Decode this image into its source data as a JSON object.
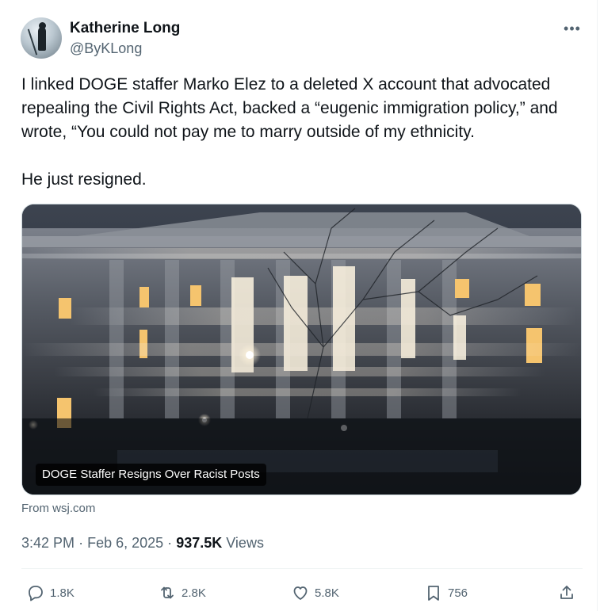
{
  "author": {
    "name": "Katherine Long",
    "handle": "@ByKLong"
  },
  "menu_icon": "more-horizontal-icon",
  "post": {
    "paragraphs": [
      "I linked DOGE staffer Marko Elez to a deleted X account that advocated repealing the Civil Rights Act, backed a “eugenic immigration policy,” and wrote, “You could not pay me to marry outside of my ethnicity.",
      "He just resigned."
    ]
  },
  "link_card": {
    "headline": "DOGE Staffer Resigns Over Racist Posts",
    "source": "From wsj.com"
  },
  "meta": {
    "time": "3:42 PM",
    "separator": "·",
    "date": "Feb 6, 2025",
    "views_count": "937.5K",
    "views_label": "Views"
  },
  "actions": {
    "replies": "1.8K",
    "reposts": "2.8K",
    "likes": "5.8K",
    "bookmarks": "756"
  },
  "colors": {
    "text_primary": "#0f1419",
    "text_secondary": "#536471",
    "border": "#eff3f4"
  }
}
